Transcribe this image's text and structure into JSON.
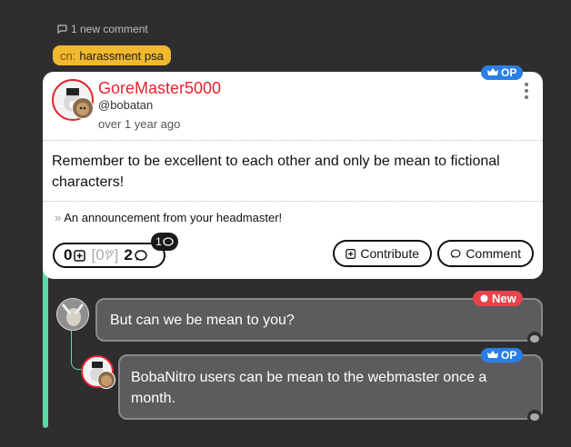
{
  "thread": {
    "new_comments_label": "1 new comment"
  },
  "content_warning": {
    "prefix": "cn:",
    "label": "harassment psa"
  },
  "post": {
    "op_label": "OP",
    "username": "GoreMaster5000",
    "handle": "@bobatan",
    "timestamp": "over 1 year ago",
    "body": "Remember to be excellent to each other and only be mean to fictional characters!",
    "whisper_marker": "»",
    "whisper": "An announcement from your headmaster!",
    "stats": {
      "comments_count": "0",
      "contributions_count": "0",
      "total_comments": "2",
      "new_comments": "1"
    },
    "contribute_label": "Contribute",
    "comment_label": "Comment"
  },
  "comments": [
    {
      "badge": "New",
      "text": "But can we be mean to you?"
    },
    {
      "badge": "OP",
      "text": "BobaNitro users can be mean to the webmaster once a month."
    }
  ],
  "colors": {
    "accent_red": "#e5232d",
    "op_blue": "#2a7fe6",
    "thread_green": "#5ed9a5",
    "cw_yellow": "#f0b92e",
    "new_red": "#e8434b"
  }
}
